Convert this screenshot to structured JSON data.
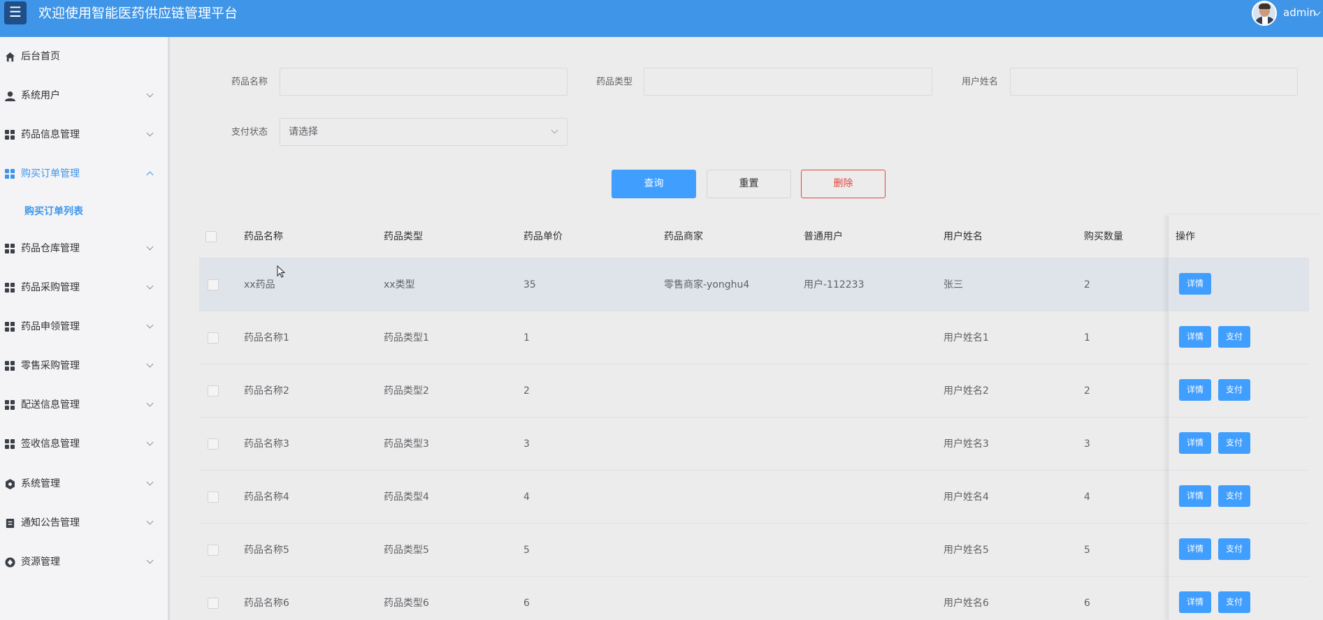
{
  "header": {
    "menu_icon": "☰",
    "title": "欢迎使用智能医药供应链管理平台",
    "user_name": "admin"
  },
  "sidebar": {
    "items": [
      {
        "label": "后台首页",
        "icon": "home-icon"
      },
      {
        "label": "系统用户",
        "icon": "user-icon"
      },
      {
        "label": "药品信息管理",
        "icon": "grid-icon"
      },
      {
        "label": "购买订单管理",
        "icon": "grid-icon",
        "active": true
      },
      {
        "label": "药品仓库管理",
        "icon": "grid-icon"
      },
      {
        "label": "药品采购管理",
        "icon": "grid-icon"
      },
      {
        "label": "药品申领管理",
        "icon": "grid-icon"
      },
      {
        "label": "零售采购管理",
        "icon": "grid-icon"
      },
      {
        "label": "配送信息管理",
        "icon": "grid-icon"
      },
      {
        "label": "签收信息管理",
        "icon": "grid-icon"
      },
      {
        "label": "系统管理",
        "icon": "gear-icon"
      },
      {
        "label": "通知公告管理",
        "icon": "notice-icon"
      },
      {
        "label": "资源管理",
        "icon": "resource-icon"
      }
    ],
    "sub_item": "购买订单列表"
  },
  "search": {
    "drug_name_label": "药品名称",
    "drug_name_value": "",
    "drug_type_label": "药品类型",
    "drug_type_value": "",
    "user_name_label": "用户姓名",
    "user_name_value": "",
    "pay_status_label": "支付状态",
    "pay_status_value": "请选择"
  },
  "buttons": {
    "query": "查询",
    "reset": "重置",
    "delete": "删除"
  },
  "table": {
    "columns": [
      "药品名称",
      "药品类型",
      "药品单价",
      "药品商家",
      "普通用户",
      "用户姓名",
      "购买数量",
      "操作"
    ],
    "rows": [
      {
        "name": "xx药品",
        "type": "xx类型",
        "price": "35",
        "merchant": "零售商家-yonghu4",
        "user": "用户-112233",
        "username": "张三",
        "qty": "2",
        "pay": false
      },
      {
        "name": "药品名称1",
        "type": "药品类型1",
        "price": "1",
        "merchant": "",
        "user": "",
        "username": "用户姓名1",
        "qty": "1",
        "pay": true
      },
      {
        "name": "药品名称2",
        "type": "药品类型2",
        "price": "2",
        "merchant": "",
        "user": "",
        "username": "用户姓名2",
        "qty": "2",
        "pay": true
      },
      {
        "name": "药品名称3",
        "type": "药品类型3",
        "price": "3",
        "merchant": "",
        "user": "",
        "username": "用户姓名3",
        "qty": "3",
        "pay": true
      },
      {
        "name": "药品名称4",
        "type": "药品类型4",
        "price": "4",
        "merchant": "",
        "user": "",
        "username": "用户姓名4",
        "qty": "4",
        "pay": true
      },
      {
        "name": "药品名称5",
        "type": "药品类型5",
        "price": "5",
        "merchant": "",
        "user": "",
        "username": "用户姓名5",
        "qty": "5",
        "pay": true
      },
      {
        "name": "药品名称6",
        "type": "药品类型6",
        "price": "6",
        "merchant": "",
        "user": "",
        "username": "用户姓名6",
        "qty": "6",
        "pay": true
      }
    ],
    "detail_label": "详情",
    "pay_label": "支付"
  },
  "colors": {
    "header": "#3f95e8",
    "primary": "#409eff",
    "danger": "#e2453c"
  }
}
